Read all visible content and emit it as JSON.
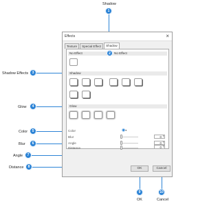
{
  "callouts": [
    {
      "number": "1",
      "label": "Shadow"
    },
    {
      "number": "2",
      "label": ""
    },
    {
      "number": "3",
      "label": "Shadow Effects"
    },
    {
      "number": "4",
      "label": "Glow"
    },
    {
      "number": "5",
      "label": "Color"
    },
    {
      "number": "6",
      "label": "Blur"
    },
    {
      "number": "7",
      "label": "Angle"
    },
    {
      "number": "8",
      "label": "Distance"
    },
    {
      "number": "9",
      "label": "OK"
    },
    {
      "number": "10",
      "label": "Cancel"
    }
  ],
  "dialog": {
    "title": "Effects",
    "close_glyph": "×",
    "tabs": [
      "Texture",
      "Special Effect",
      "Shadow"
    ],
    "active_tab": "Shadow",
    "sections": {
      "no_effect": "No Effect",
      "no_effect_side": "No Effect",
      "shadow": "Shadow",
      "glow": "Glow"
    },
    "rows": {
      "color": {
        "label": "Color",
        "icon": "color-picker-icon"
      },
      "blur": {
        "label": "Blur",
        "value": "0"
      },
      "angle": {
        "label": "Angle",
        "value": "0"
      },
      "distance": {
        "label": "Distance",
        "value": "0"
      }
    },
    "ok_label": "OK",
    "cancel_label": "Cancel",
    "shadow_presets": 8,
    "glow_presets": 4
  },
  "colors": {
    "accent": "#2b83d6"
  }
}
